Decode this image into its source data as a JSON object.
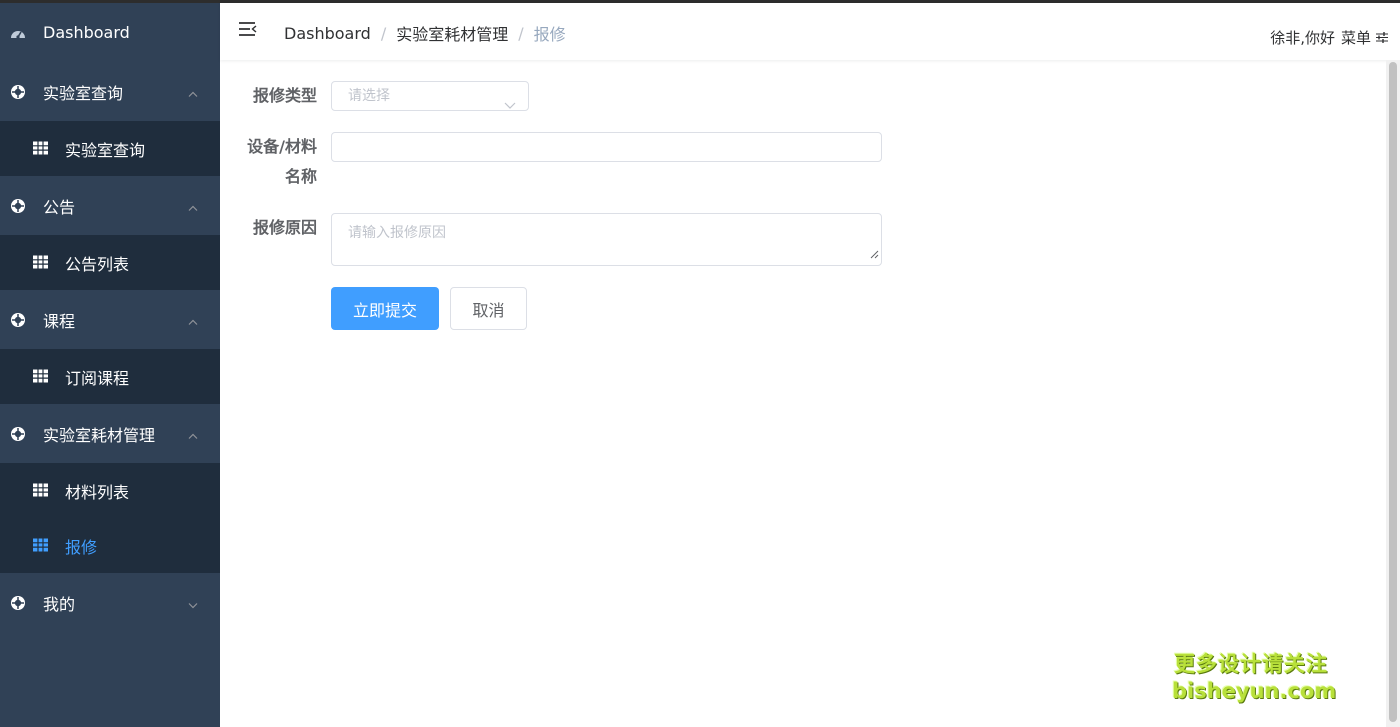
{
  "sidebar": {
    "dashboard": "Dashboard",
    "groups": [
      {
        "title": "实验室查询",
        "items": [
          {
            "label": "实验室查询",
            "active": false
          }
        ]
      },
      {
        "title": "公告",
        "items": [
          {
            "label": "公告列表",
            "active": false
          }
        ]
      },
      {
        "title": "课程",
        "items": [
          {
            "label": "订阅课程",
            "active": false
          }
        ]
      },
      {
        "title": "实验室耗材管理",
        "items": [
          {
            "label": "材料列表",
            "active": false
          },
          {
            "label": "报修",
            "active": true
          }
        ]
      }
    ],
    "last_group": "我的"
  },
  "header": {
    "breadcrumb": [
      "Dashboard",
      "实验室耗材管理",
      "报修"
    ],
    "greeting": "徐非,你好",
    "menu_label": "菜单"
  },
  "form": {
    "repair_type_label": "报修类型",
    "repair_type_placeholder": "请选择",
    "name_label_line1": "设备/材料",
    "name_label_line2": "名称",
    "name_value": "",
    "reason_label": "报修原因",
    "reason_placeholder": "请输入报修原因",
    "submit_label": "立即提交",
    "cancel_label": "取消"
  },
  "watermark": {
    "line1": "更多设计请关注",
    "line2": "bisheyun.com"
  },
  "colors": {
    "sidebar_bg": "#304156",
    "submenu_bg": "#1f2d3d",
    "accent": "#409eff"
  }
}
